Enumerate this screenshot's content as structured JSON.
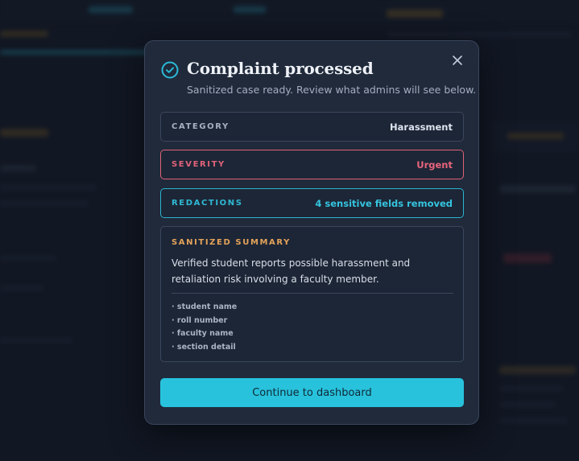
{
  "modal": {
    "title": "Complaint processed",
    "subtitle": "Sanitized case ready. Review what admins will see below.",
    "close_icon": "close-icon",
    "status_icon": "check-circle-icon",
    "fields": {
      "category": {
        "label": "CATEGORY",
        "value": "Harassment"
      },
      "severity": {
        "label": "SEVERITY",
        "value": "Urgent"
      },
      "redactions": {
        "label": "REDACTIONS",
        "value": "4 sensitive fields removed"
      }
    },
    "summary": {
      "label": "SANITIZED SUMMARY",
      "text": "Verified student reports possible harassment and retaliation risk involving a faculty member.",
      "removed": [
        "· student name",
        "· roll number",
        "· faculty name",
        "· section detail"
      ]
    },
    "cta_label": "Continue to dashboard"
  },
  "colors": {
    "accent": "#28c2dd",
    "severity": "#e0627a",
    "summary_label": "#e3a35a",
    "panel": "#202a3b"
  }
}
